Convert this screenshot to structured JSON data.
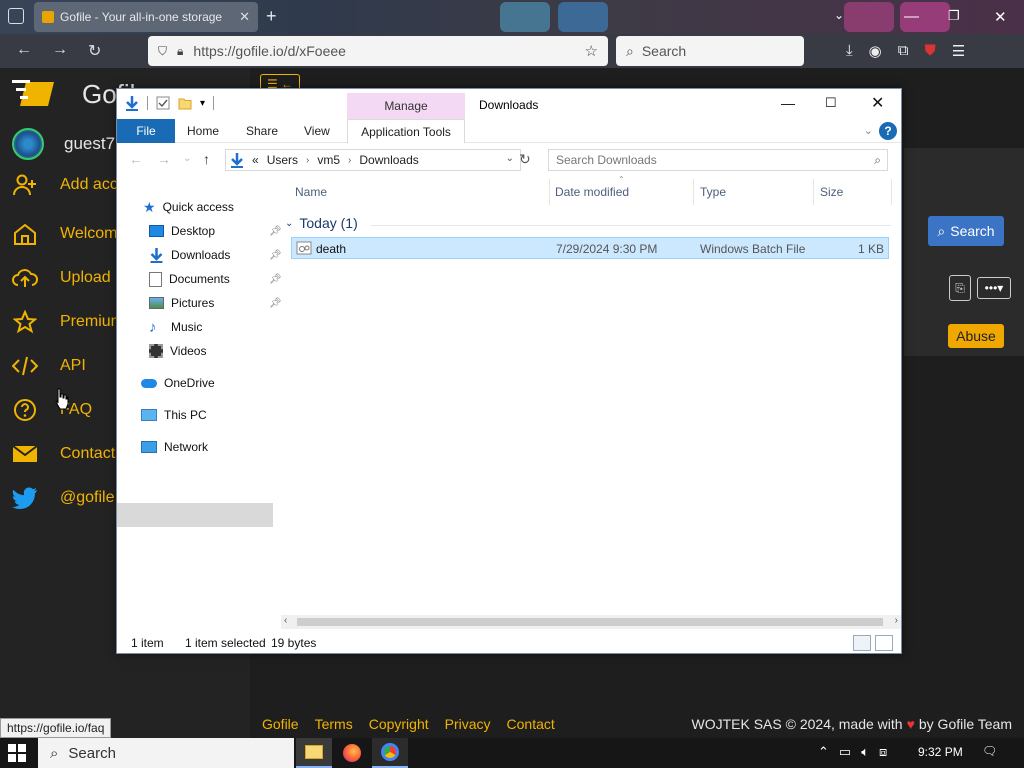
{
  "browser": {
    "tab_title": "Gofile - Your all-in-one storage",
    "url": "https://gofile.io/d/xFoeee",
    "search_placeholder": "Search",
    "status_url": "https://gofile.io/faq"
  },
  "site": {
    "title": "Gofile",
    "guest": "guest7",
    "sidebar": [
      {
        "label": "Add account",
        "icon": "add-user-icon"
      },
      {
        "label": "Welcome",
        "icon": "home-icon"
      },
      {
        "label": "Upload",
        "icon": "upload-icon"
      },
      {
        "label": "Premium",
        "icon": "star-icon"
      },
      {
        "label": "API",
        "icon": "code-icon"
      },
      {
        "label": "FAQ",
        "icon": "question-icon"
      },
      {
        "label": "Contact",
        "icon": "mail-icon"
      },
      {
        "label": "@gofile",
        "icon": "twitter-icon"
      }
    ],
    "search_button": "Search",
    "abuse_button": "Abuse",
    "footer_links": [
      "Gofile",
      "Terms",
      "Copyright",
      "Privacy",
      "Contact"
    ],
    "copyright_prefix": "WOJTEK SAS © 2024, made with",
    "copyright_suffix": "by Gofile Team"
  },
  "explorer": {
    "window_title": "Downloads",
    "context_group": "Manage",
    "ribbon_tabs": [
      "File",
      "Home",
      "Share",
      "View",
      "Application Tools"
    ],
    "address": [
      "Users",
      "vm5",
      "Downloads"
    ],
    "address_prefix": "«",
    "search_placeholder": "Search Downloads",
    "nav": [
      {
        "label": "Quick access",
        "icon": "star-icon",
        "pinned": false
      },
      {
        "label": "Desktop",
        "icon": "desktop-icon",
        "pinned": true
      },
      {
        "label": "Downloads",
        "icon": "download-icon",
        "pinned": true
      },
      {
        "label": "Documents",
        "icon": "documents-icon",
        "pinned": true
      },
      {
        "label": "Pictures",
        "icon": "pictures-icon",
        "pinned": true
      },
      {
        "label": "Music",
        "icon": "music-icon",
        "pinned": false
      },
      {
        "label": "Videos",
        "icon": "videos-icon",
        "pinned": false
      },
      {
        "label": "OneDrive",
        "icon": "cloud-icon",
        "pinned": false
      },
      {
        "label": "This PC",
        "icon": "computer-icon",
        "pinned": false
      },
      {
        "label": "Network",
        "icon": "network-icon",
        "pinned": false
      }
    ],
    "columns": [
      "Name",
      "Date modified",
      "Type",
      "Size"
    ],
    "group": "Today (1)",
    "files": [
      {
        "name": "death",
        "date": "7/29/2024 9:30 PM",
        "type": "Windows Batch File",
        "size": "1 KB"
      }
    ],
    "status": {
      "count": "1 item",
      "selected": "1 item selected",
      "bytes": "19 bytes"
    }
  },
  "taskbar": {
    "search": "Search",
    "time": "9:32 PM"
  }
}
